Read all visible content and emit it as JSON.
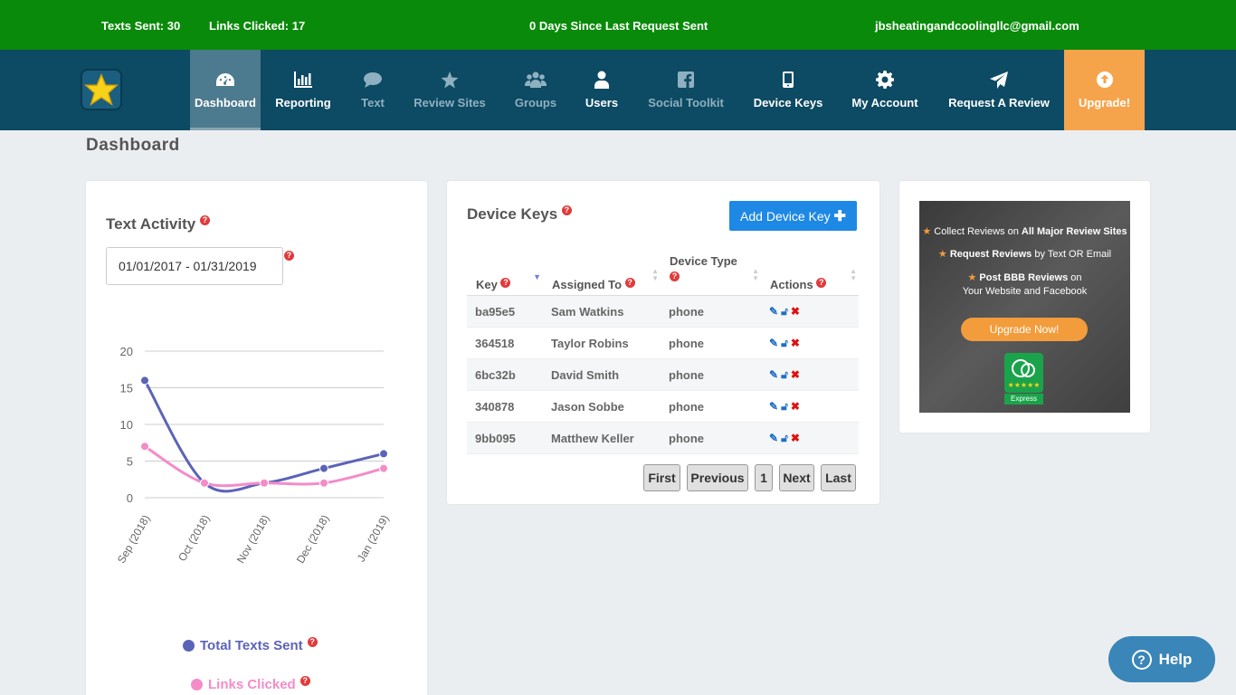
{
  "topbar": {
    "texts_sent": "Texts Sent: 30",
    "links_clicked": "Links Clicked: 17",
    "days_since": "0 Days Since Last Request Sent",
    "email": "jbsheatingandcoolingllc@gmail.com"
  },
  "nav": {
    "dashboard": "Dashboard",
    "reporting": "Reporting",
    "text": "Text",
    "review_sites": "Review Sites",
    "groups": "Groups",
    "users": "Users",
    "social_toolkit": "Social Toolkit",
    "device_keys": "Device Keys",
    "my_account": "My Account",
    "request_review": "Request A Review",
    "upgrade": "Upgrade!"
  },
  "page_title": "Dashboard",
  "text_activity": {
    "title": "Text Activity",
    "date_range": "01/01/2017 - 01/31/2019",
    "legend_total": "Total Texts Sent",
    "legend_links": "Links Clicked"
  },
  "chart_data": {
    "type": "line",
    "categories": [
      "Sep (2018)",
      "Oct (2018)",
      "Nov (2018)",
      "Dec (2018)",
      "Jan (2019)"
    ],
    "series": [
      {
        "name": "Total Texts Sent",
        "values": [
          16,
          2,
          2,
          4,
          6
        ],
        "color": "#5b63b7"
      },
      {
        "name": "Links Clicked",
        "values": [
          7,
          2,
          2,
          2,
          4
        ],
        "color": "#f48cc8"
      }
    ],
    "yticks": [
      0,
      5,
      10,
      15,
      20
    ],
    "ylim": [
      0,
      20
    ],
    "grid": true
  },
  "device_keys": {
    "title": "Device Keys",
    "add_button": "Add Device Key",
    "columns": {
      "key": "Key",
      "assigned": "Assigned To",
      "type": "Device Type",
      "actions": "Actions"
    },
    "rows": [
      {
        "key": "ba95e5",
        "assigned": "Sam Watkins",
        "type": "phone"
      },
      {
        "key": "364518",
        "assigned": "Taylor Robins",
        "type": "phone"
      },
      {
        "key": "6bc32b",
        "assigned": "David Smith",
        "type": "phone"
      },
      {
        "key": "340878",
        "assigned": "Jason Sobbe",
        "type": "phone"
      },
      {
        "key": "9bb095",
        "assigned": "Matthew Keller",
        "type": "phone"
      }
    ],
    "pagination": {
      "first": "First",
      "previous": "Previous",
      "page": "1",
      "next": "Next",
      "last": "Last"
    }
  },
  "ad": {
    "line1_a": "Collect Reviews on ",
    "line1_b": "All Major Review Sites",
    "line2_a": "Request Reviews",
    "line2_b": " by Text OR Email",
    "line3_a": "Post BBB Reviews",
    "line3_b": " on",
    "line4": "Your Website and Facebook",
    "button": "Upgrade Now!",
    "app_label": "Express"
  },
  "help_button": "Help",
  "colors": {
    "topbar": "#0a8a0a",
    "navbar": "#0d4a63",
    "upgrade": "#f6a44c",
    "add_button": "#1e88e5"
  }
}
